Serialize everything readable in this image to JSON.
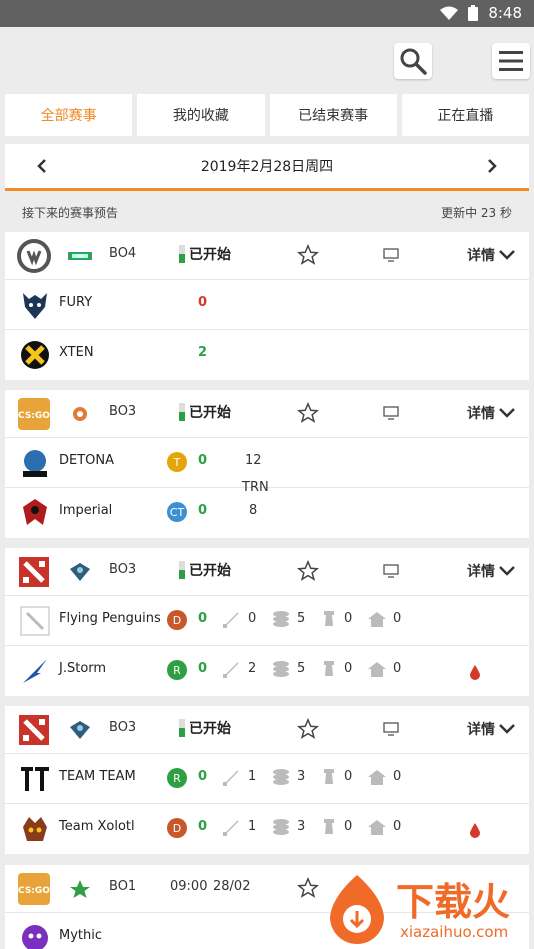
{
  "status_bar": {
    "time": "8:48"
  },
  "tabs": [
    {
      "label": "全部赛事",
      "active": true
    },
    {
      "label": "我的收藏",
      "active": false
    },
    {
      "label": "已结束赛事",
      "active": false
    },
    {
      "label": "正在直播",
      "active": false
    }
  ],
  "date_nav": {
    "date": "2019年2月28日周四"
  },
  "info": {
    "left": "接下来的赛事预告",
    "right": "更新中 23 秒"
  },
  "common": {
    "started": "已开始",
    "detail": "详情"
  },
  "matches": [
    {
      "game": "overwatch",
      "bo": "BO4",
      "teams": [
        {
          "name": "FURY",
          "score": "0"
        },
        {
          "name": "XTEN",
          "score": "2"
        }
      ]
    },
    {
      "game": "csgo",
      "bo": "BO3",
      "map": "TRN",
      "teams": [
        {
          "name": "DETONA",
          "side": "T",
          "score": "0",
          "rounds": "12"
        },
        {
          "name": "Imperial",
          "side": "CT",
          "score": "0",
          "rounds": "8"
        }
      ]
    },
    {
      "game": "dota2",
      "bo": "BO3",
      "teams": [
        {
          "name": "Flying Penguins",
          "side": "D",
          "score": "0",
          "kills": "0",
          "gold": "5",
          "towers": "0",
          "barracks": "0"
        },
        {
          "name": "J.Storm",
          "side": "R",
          "score": "0",
          "kills": "2",
          "gold": "5",
          "towers": "0",
          "barracks": "0"
        }
      ]
    },
    {
      "game": "dota2",
      "bo": "BO3",
      "teams": [
        {
          "name": "TEAM TEAM",
          "side": "R",
          "score": "0",
          "kills": "1",
          "gold": "3",
          "towers": "0",
          "barracks": "0"
        },
        {
          "name": "Team Xolotl",
          "side": "D",
          "score": "0",
          "kills": "1",
          "gold": "3",
          "towers": "0",
          "barracks": "0"
        }
      ]
    },
    {
      "game": "csgo",
      "bo": "BO1",
      "time": "09:00",
      "date": "28/02",
      "teams": [
        {
          "name": "Mythic"
        }
      ]
    }
  ],
  "watermark": {
    "brand": "下载火",
    "url": "xiazaihuo.com"
  },
  "colors": {
    "accent": "#f08a24",
    "win": "#2ea043",
    "lose": "#d33a2c",
    "t_side": "#e5a50a",
    "ct_side": "#3d8fd1",
    "dire": "#c8582a",
    "radiant": "#2ea043"
  }
}
